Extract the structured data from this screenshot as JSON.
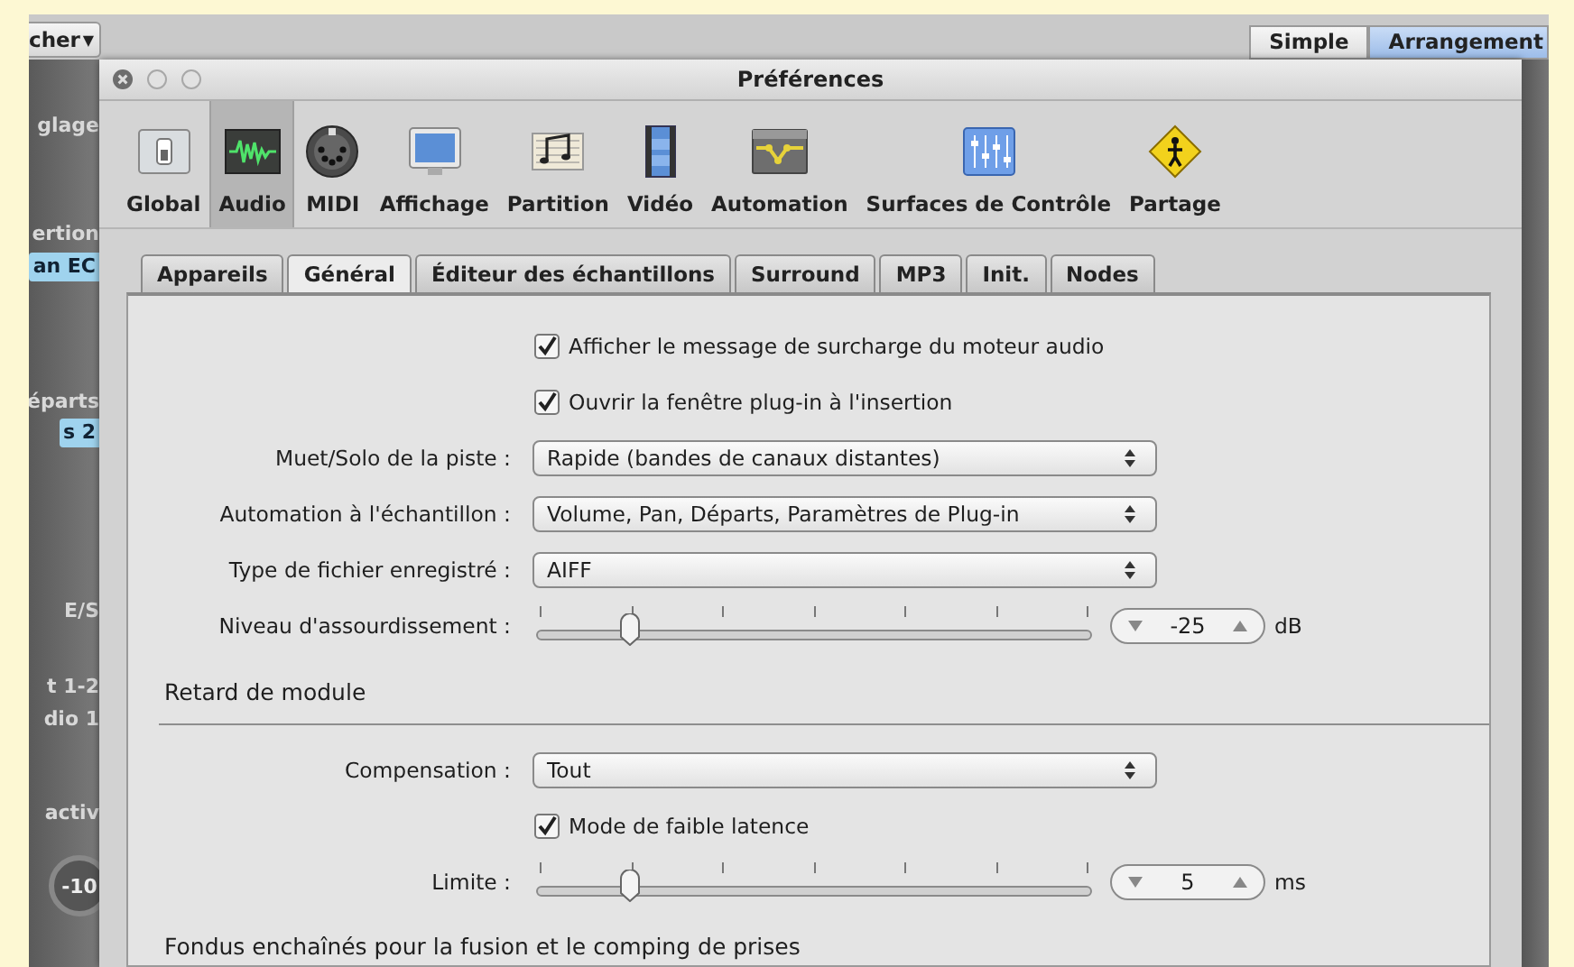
{
  "background_app": {
    "view_menu": {
      "label": "cher",
      "arrow": "▼"
    },
    "mode_tabs": [
      {
        "label": "Simple",
        "selected": false
      },
      {
        "label": "Arrangement",
        "selected": true
      }
    ],
    "left_strip": [
      {
        "kind": "label",
        "text": "glage"
      },
      {
        "kind": "label",
        "text": "ertion"
      },
      {
        "kind": "button",
        "text": "an EC"
      },
      {
        "kind": "label",
        "text": "éparts"
      },
      {
        "kind": "button",
        "text": "s 2"
      },
      {
        "kind": "label",
        "text": "E/S"
      },
      {
        "kind": "label",
        "text": "t 1-2"
      },
      {
        "kind": "label",
        "text": "dio 1"
      },
      {
        "kind": "label",
        "text": "activ"
      },
      {
        "kind": "knob",
        "text": "-10"
      }
    ]
  },
  "window": {
    "title": "Préférences",
    "toolbar": [
      {
        "label": "Global",
        "selected": false
      },
      {
        "label": "Audio",
        "selected": true
      },
      {
        "label": "MIDI",
        "selected": false
      },
      {
        "label": "Affichage",
        "selected": false
      },
      {
        "label": "Partition",
        "selected": false
      },
      {
        "label": "Vidéo",
        "selected": false
      },
      {
        "label": "Automation",
        "selected": false
      },
      {
        "label": "Surfaces de Contrôle",
        "selected": false
      },
      {
        "label": "Partage",
        "selected": false
      }
    ],
    "tabs": [
      {
        "label": "Appareils",
        "selected": false
      },
      {
        "label": "Général",
        "selected": true
      },
      {
        "label": "Éditeur des échantillons",
        "selected": false
      },
      {
        "label": "Surround",
        "selected": false
      },
      {
        "label": "MP3",
        "selected": false
      },
      {
        "label": "Init.",
        "selected": false
      },
      {
        "label": "Nodes",
        "selected": false
      }
    ],
    "settings": [
      {
        "kind": "checkbox",
        "label": "Afficher le message de surcharge du moteur audio",
        "checked": true
      },
      {
        "kind": "checkbox",
        "label": "Ouvrir la fenêtre plug-in à l'insertion",
        "checked": true
      },
      {
        "kind": "popup",
        "label": "Muet/Solo de la piste :",
        "value": "Rapide (bandes de canaux distantes)"
      },
      {
        "kind": "popup",
        "label": "Automation à l'échantillon :",
        "value": "Volume, Pan, Départs, Paramètres de Plug-in"
      },
      {
        "kind": "popup",
        "label": "Type de fichier enregistré :",
        "value": "AIFF"
      },
      {
        "kind": "slider",
        "label": "Niveau d'assourdissement :",
        "level": 0.17,
        "value": "-25",
        "unit": "dB"
      },
      {
        "kind": "section",
        "label": "Retard de module"
      },
      {
        "kind": "popup",
        "label": "Compensation :",
        "value": "Tout"
      },
      {
        "kind": "checkbox",
        "label": "Mode de faible latence",
        "checked": true
      },
      {
        "kind": "slider",
        "label": "Limite :",
        "level": 0.17,
        "value": "5",
        "unit": "ms"
      },
      {
        "kind": "section",
        "label": "Fondus enchaînés pour la fusion et le comping de prises"
      }
    ]
  }
}
